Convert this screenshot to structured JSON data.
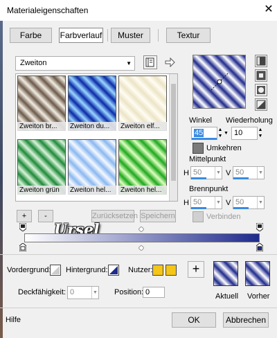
{
  "window": {
    "title": "Materialeigenschaften",
    "close_glyph": "✕"
  },
  "tabs": [
    {
      "label": "Farbe",
      "active": false
    },
    {
      "label": "Farbverlauf",
      "active": true
    },
    {
      "label": "Muster",
      "active": false
    },
    {
      "label": "Textur",
      "active": false
    }
  ],
  "preset": {
    "selected": "Zweiton"
  },
  "gallery": {
    "items": [
      {
        "label": "Zweiton br...",
        "c1": "#f2ece2",
        "c2": "#6b5a4a"
      },
      {
        "label": "Zweiton du...",
        "c1": "#9ad6ff",
        "c2": "#0b2aa8"
      },
      {
        "label": "Zweiton elf...",
        "c1": "#fffdf3",
        "c2": "#ece4c6"
      },
      {
        "label": "Zweiton grün",
        "c1": "#d9f3d9",
        "c2": "#1f8a3a"
      },
      {
        "label": "Zweiton hel...",
        "c1": "#f4f8ff",
        "c2": "#8ab8f0"
      },
      {
        "label": "Zweiton hel...",
        "c1": "#dfffc0",
        "c2": "#1ea81e"
      }
    ]
  },
  "buttons": {
    "add": "+",
    "remove": "-",
    "reset": "Zurücksetzen",
    "save": "Speichern"
  },
  "watermark": "Ursel",
  "gradient": {
    "start_color": "#ffffff",
    "end_color": "#1f2a8c"
  },
  "settings": {
    "angle_label": "Winkel",
    "angle_value": "45",
    "repeat_label": "Wiederholung",
    "repeat_value": "10",
    "invert_label": "Umkehren",
    "midpoint_label": "Mittelpunkt",
    "mid_h": "50",
    "mid_v": "50",
    "focus_label": "Brennpunkt",
    "focus_h": "50",
    "focus_v": "50",
    "h_label": "H",
    "v_label": "V",
    "link_label": "Verbinden"
  },
  "bottom": {
    "foreground_label": "Vordergrund:",
    "background_label": "Hintergrund:",
    "user_label": "Nutzer:",
    "user_color": "#f5c518",
    "opacity_label": "Deckfähigkeit:",
    "opacity_value": "0",
    "position_label": "Position:",
    "position_value": "0",
    "current_label": "Aktuell",
    "previous_label": "Vorher"
  },
  "footer": {
    "help": "Hilfe",
    "ok": "OK",
    "cancel": "Abbrechen"
  }
}
